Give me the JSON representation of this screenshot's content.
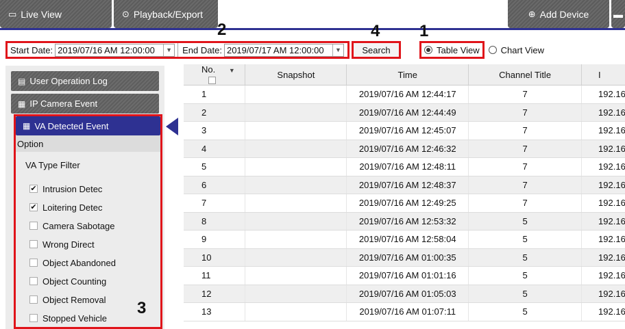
{
  "tabs": {
    "live": "Live View",
    "playback": "Playback/Export",
    "add_device": "Add Device"
  },
  "filter": {
    "start_label": "Start Date:",
    "start_value": "2019/07/16 AM 12:00:00",
    "end_label": "End Date:",
    "end_value": "2019/07/17 AM 12:00:00",
    "search": "Search",
    "table_view": "Table View",
    "chart_view": "Chart View"
  },
  "annotations": {
    "n1": "1",
    "n2": "2",
    "n3": "3",
    "n4": "4"
  },
  "sidebar": {
    "user_log": "User Operation Log",
    "ip_event": "IP Camera Event",
    "va_event": "VA Detected Event",
    "option": "Option",
    "va_type_filter": "VA Type Filter",
    "filters": [
      {
        "label": "Intrusion Detec",
        "checked": true
      },
      {
        "label": "Loitering Detec",
        "checked": true
      },
      {
        "label": "Camera Sabotage",
        "checked": false
      },
      {
        "label": "Wrong Direct",
        "checked": false
      },
      {
        "label": "Object Abandoned",
        "checked": false
      },
      {
        "label": "Object Counting",
        "checked": false
      },
      {
        "label": "Object Removal",
        "checked": false
      },
      {
        "label": "Stopped Vehicle",
        "checked": false
      }
    ]
  },
  "table": {
    "headers": {
      "no": "No.",
      "snapshot": "Snapshot",
      "time": "Time",
      "channel": "Channel Title",
      "ip": "I"
    },
    "rows": [
      {
        "no": "1",
        "time": "2019/07/16 AM 12:44:17",
        "channel": "7",
        "ip": "192.16"
      },
      {
        "no": "2",
        "time": "2019/07/16 AM 12:44:49",
        "channel": "7",
        "ip": "192.16"
      },
      {
        "no": "3",
        "time": "2019/07/16 AM 12:45:07",
        "channel": "7",
        "ip": "192.16"
      },
      {
        "no": "4",
        "time": "2019/07/16 AM 12:46:32",
        "channel": "7",
        "ip": "192.16"
      },
      {
        "no": "5",
        "time": "2019/07/16 AM 12:48:11",
        "channel": "7",
        "ip": "192.16"
      },
      {
        "no": "6",
        "time": "2019/07/16 AM 12:48:37",
        "channel": "7",
        "ip": "192.16"
      },
      {
        "no": "7",
        "time": "2019/07/16 AM 12:49:25",
        "channel": "7",
        "ip": "192.16"
      },
      {
        "no": "8",
        "time": "2019/07/16 AM 12:53:32",
        "channel": "5",
        "ip": "192.16"
      },
      {
        "no": "9",
        "time": "2019/07/16 AM 12:58:04",
        "channel": "5",
        "ip": "192.16"
      },
      {
        "no": "10",
        "time": "2019/07/16 AM 01:00:35",
        "channel": "5",
        "ip": "192.16"
      },
      {
        "no": "11",
        "time": "2019/07/16 AM 01:01:16",
        "channel": "5",
        "ip": "192.16"
      },
      {
        "no": "12",
        "time": "2019/07/16 AM 01:05:03",
        "channel": "5",
        "ip": "192.16"
      },
      {
        "no": "13",
        "time": "2019/07/16 AM 01:07:11",
        "channel": "5",
        "ip": "192.16"
      }
    ]
  },
  "colors": {
    "accent": "#2e3192",
    "highlight": "#e0141a",
    "tab_gray": "#636363"
  }
}
